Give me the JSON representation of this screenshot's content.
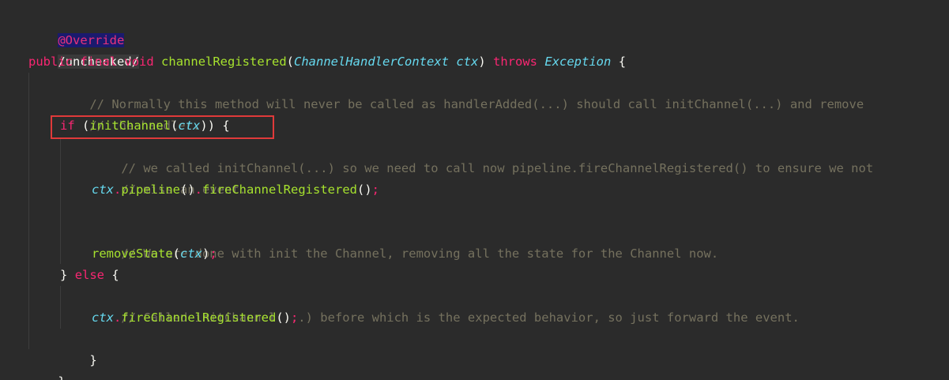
{
  "colors": {
    "background": "#2b2b2b",
    "keyword": "#f92672",
    "function": "#a6e22e",
    "type": "#66d9ef",
    "comment": "#75715e",
    "plain": "#f8f8f2",
    "annotation_bg": "#1a1a6e",
    "highlight_box": "#e03a3a"
  },
  "code": {
    "line1": {
      "annotation": "@Override"
    },
    "line2": {
      "suppress": "/unchecked/"
    },
    "line3": {
      "kw_public": "public",
      "kw_final": "final",
      "kw_void": "void",
      "method": "channelRegistered",
      "paren_open": "(",
      "param_type": "ChannelHandlerContext",
      "param_name": "ctx",
      "paren_close": ")",
      "kw_throws": "throws",
      "exception": "Exception",
      "brace": "{"
    },
    "line4": {
      "comment": "// Normally this method will never be called as handlerAdded(...) should call initChannel(...) and remove"
    },
    "line5": {
      "comment": "// the handler."
    },
    "line6": {
      "kw_if": "if",
      "paren_open": "(",
      "call": "initChannel",
      "inner_open": "(",
      "arg": "ctx",
      "inner_close": "))",
      "brace": "{"
    },
    "line7": {
      "comment": "// we called initChannel(...) so we need to call now pipeline.fireChannelRegistered() to ensure we not"
    },
    "line8": {
      "comment": "// miss an event."
    },
    "line9": {
      "obj": "ctx",
      "dot1": ".",
      "m1": "pipeline",
      "p1": "()",
      "dot2": ".",
      "m2": "fireChannelRegistered",
      "p2": "()",
      "semi": ";"
    },
    "line11": {
      "comment": "// We are done with init the Channel, removing all the state for the Channel now."
    },
    "line12": {
      "m": "removeState",
      "open": "(",
      "arg": "ctx",
      "close": ")",
      "semi": ";"
    },
    "line13": {
      "close": "}",
      "kw_else": "else",
      "open": "{"
    },
    "line14": {
      "comment": "// Called initChannel(...) before which is the expected behavior, so just forward the event."
    },
    "line15": {
      "obj": "ctx",
      "dot": ".",
      "m": "fireChannelRegistered",
      "p": "()",
      "semi": ";"
    },
    "line16": {
      "close": "}"
    },
    "line17": {
      "close": "}"
    }
  }
}
